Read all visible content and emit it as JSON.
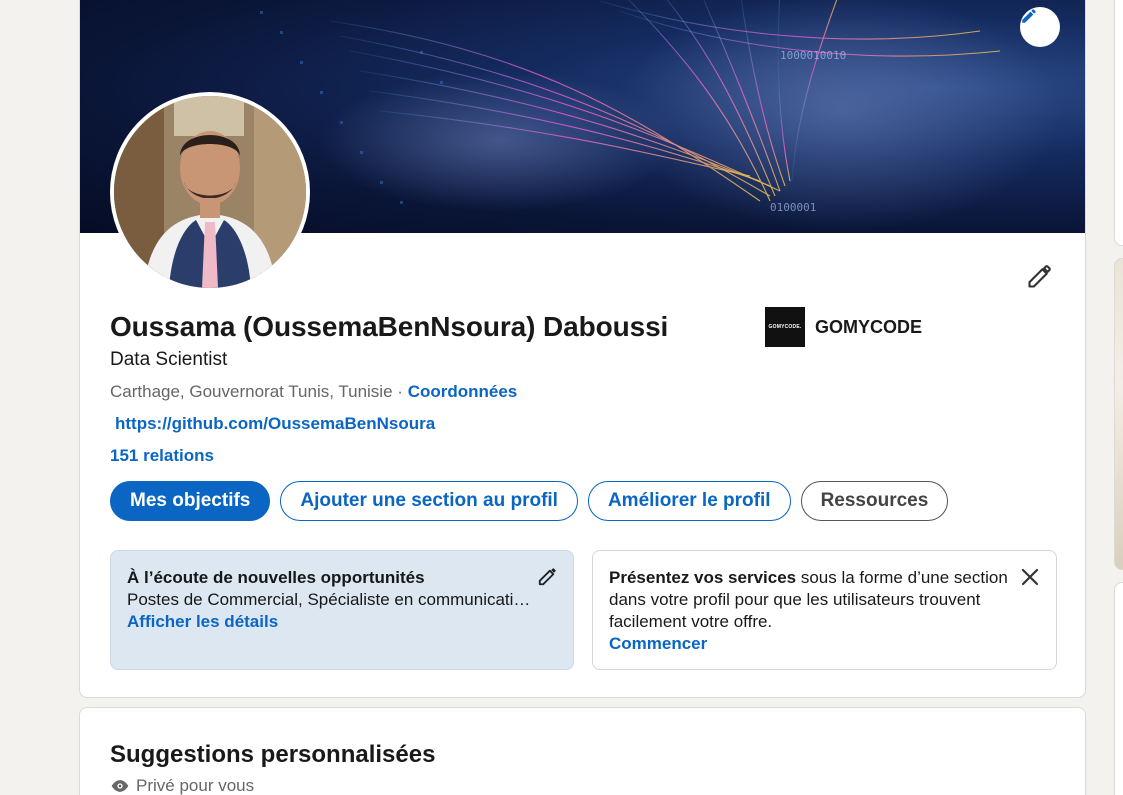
{
  "profile": {
    "name": "Oussama (OussemaBenNsoura) Daboussi",
    "headline": "Data Scientist",
    "location": "Carthage, Gouvernorat Tunis, Tunisie",
    "separator": "·",
    "contact_link": "Coordonnées",
    "website": "https://github.com/OussemaBenNsoura",
    "connections": "151 relations"
  },
  "company": {
    "logo_text": "GOMYCODE.",
    "name": "GOMYCODE"
  },
  "actions": {
    "goals": "Mes objectifs",
    "add_section": "Ajouter une section au profil",
    "improve": "Améliorer le profil",
    "resources": "Ressources"
  },
  "open_to_work": {
    "title": "À l’écoute de nouvelles opportunités",
    "text": "Postes de Commercial, Spécialiste en communicati…",
    "link": "Afficher les détails"
  },
  "services": {
    "title_bold": "Présentez vos services",
    "text": " sous la forme d’une section dans votre profil pour que les utilisateurs trouvent facilement votre offre.",
    "link": "Commencer"
  },
  "suggestions": {
    "title": "Suggestions personnalisées",
    "private_label": "Privé pour vous"
  },
  "colors": {
    "accent": "#0a66c2",
    "open_to_work_bg": "#dde7f1"
  }
}
